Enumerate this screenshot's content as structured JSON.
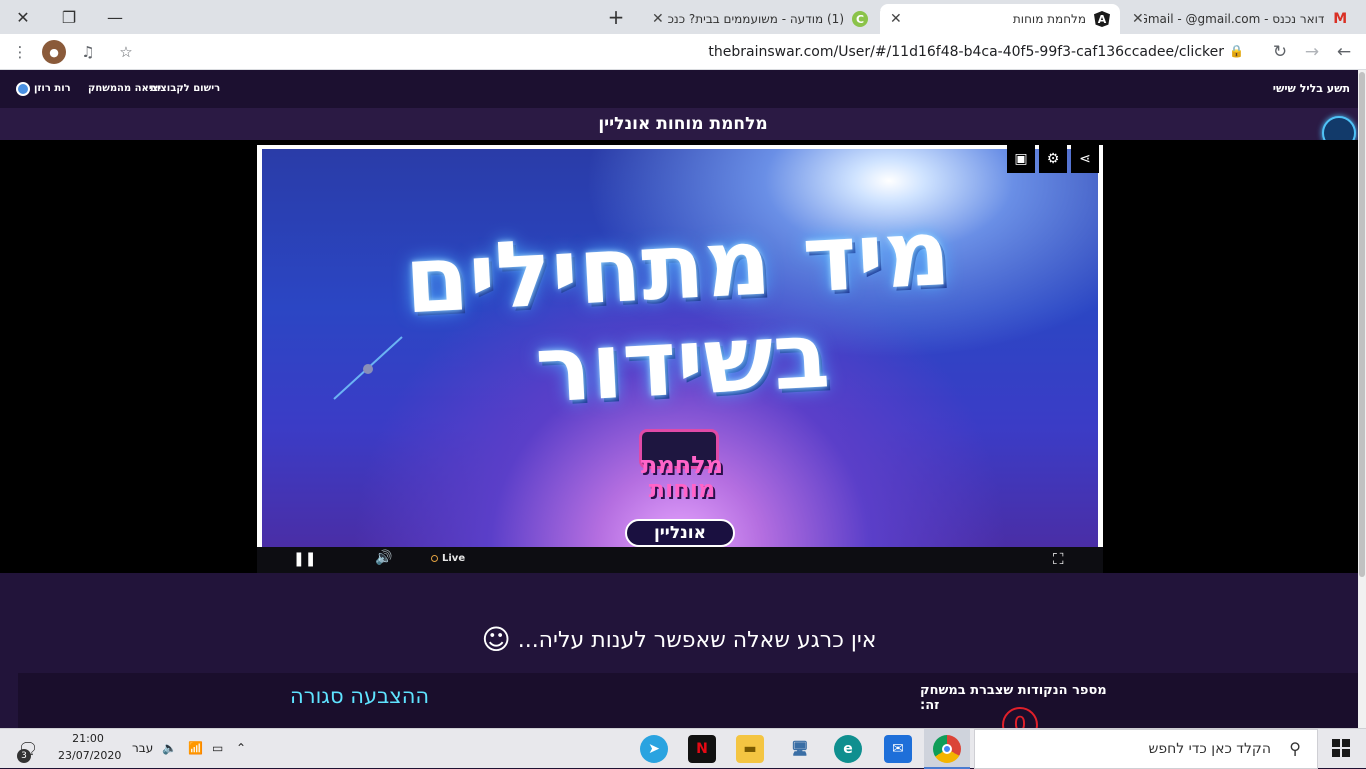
{
  "browser": {
    "tabs": [
      {
        "title": "דואר נכנס - Gmail - @gmail.com",
        "icon": "gmail-icon",
        "active": false
      },
      {
        "title": "מלחמת מוחות",
        "icon": "angular-icon",
        "active": true
      },
      {
        "title": "(1) מודעה - משועממים בבית? כנכ",
        "icon": "app-icon",
        "active": false
      }
    ],
    "url": "thebrainswar.com/User/#/11d16f48-b4ca-40f5-99f3-caf136ccadee/clicker"
  },
  "site": {
    "nav_right": "תשע בליל שישי",
    "nav_left": [
      "רישום לקבוצות",
      "יציאה מהמשחק",
      "רות רוזן"
    ],
    "page_title": "מלחמת מוחות אונליין"
  },
  "video": {
    "headline_line1": "מיד מתחילים",
    "headline_line2": "בשידור",
    "logo_top": "מלחמת",
    "logo_mid": "מוחות",
    "logo_bottom": "אונליין",
    "live_label": "Live"
  },
  "game": {
    "no_question": "אין כרגע שאלה שאפשר לענות עליה...",
    "smiley": "☺",
    "vote_status": "ההצבעה סגורה",
    "points_label": "מספר הנקודות שצברת במשחק זה:",
    "points_value": "0"
  },
  "taskbar": {
    "search_placeholder": "הקלד כאן כדי לחפש",
    "time": "21:00",
    "date": "23/07/2020",
    "language": "עבר",
    "notifications": "3"
  },
  "colors": {
    "site_bg": "#1f1233",
    "vote_color": "#5fe3ff",
    "points_color": "#e0202a"
  }
}
